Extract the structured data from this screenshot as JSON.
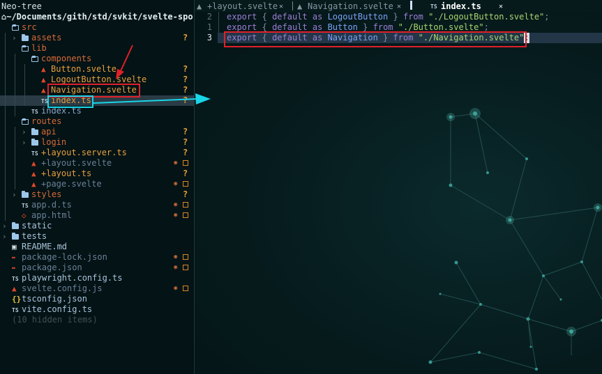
{
  "neotree": {
    "title": "Neo-tree",
    "root_path": "~/Documents/gith/std/svkit/svelte-spo",
    "hidden_items": "(10 hidden items)",
    "items": [
      {
        "label": "src",
        "kind": "folder-open",
        "icon": "folder-open-icon",
        "color": "#d86a3a",
        "git": ""
      },
      {
        "label": "assets",
        "kind": "folder",
        "icon": "folder-icon",
        "color": "#d86a3a",
        "git": "?"
      },
      {
        "label": "lib",
        "kind": "folder-open",
        "icon": "folder-open-icon",
        "color": "#d86a3a",
        "git": ""
      },
      {
        "label": "components",
        "kind": "folder-open",
        "icon": "folder-open-icon",
        "color": "#d86a3a",
        "git": ""
      },
      {
        "label": "Button.svelte",
        "kind": "svelte",
        "icon": "svelte-icon",
        "color": "#e8a040",
        "git": "?"
      },
      {
        "label": "LogoutButton.svelte",
        "kind": "svelte",
        "icon": "svelte-icon",
        "color": "#e8a040",
        "git": "?"
      },
      {
        "label": "Navigation.svelte",
        "kind": "svelte",
        "icon": "svelte-icon",
        "color": "#e8a040",
        "git": "?"
      },
      {
        "label": "index.ts",
        "kind": "ts",
        "icon": "typescript-icon",
        "color": "#e8a040",
        "git": "?"
      },
      {
        "label": "index.ts",
        "kind": "ts",
        "icon": "typescript-icon",
        "color": "#8aa6c8",
        "git": ""
      },
      {
        "label": "routes",
        "kind": "folder-open",
        "icon": "folder-open-icon",
        "color": "#d86a3a",
        "git": ""
      },
      {
        "label": "api",
        "kind": "folder",
        "icon": "folder-icon",
        "color": "#d86a3a",
        "git": "?"
      },
      {
        "label": "login",
        "kind": "folder",
        "icon": "folder-icon",
        "color": "#d86a3a",
        "git": "?"
      },
      {
        "label": "+layout.server.ts",
        "kind": "ts",
        "icon": "typescript-icon",
        "color": "#e8a040",
        "git": "?"
      },
      {
        "label": "+layout.svelte",
        "kind": "svelte",
        "icon": "svelte-icon",
        "color": "#6b8098",
        "git": "modified"
      },
      {
        "label": "+layout.ts",
        "kind": "svelte",
        "icon": "svelte-icon",
        "color": "#e8a040",
        "git": "?"
      },
      {
        "label": "+page.svelte",
        "kind": "svelte",
        "icon": "svelte-icon",
        "color": "#6b8098",
        "git": "modified"
      },
      {
        "label": "styles",
        "kind": "folder",
        "icon": "folder-icon",
        "color": "#d86a3a",
        "git": "?"
      },
      {
        "label": "app.d.ts",
        "kind": "ts",
        "icon": "typescript-icon",
        "color": "#6b8098",
        "git": "modified"
      },
      {
        "label": "app.html",
        "kind": "html",
        "icon": "html-icon",
        "color": "#6b8098",
        "git": "modified"
      },
      {
        "label": "static",
        "kind": "folder",
        "icon": "folder-icon",
        "color": "#a9c4dd",
        "git": ""
      },
      {
        "label": "tests",
        "kind": "folder",
        "icon": "folder-icon",
        "color": "#a9c4dd",
        "git": ""
      },
      {
        "label": "README.md",
        "kind": "md",
        "icon": "markdown-icon",
        "color": "#a9c4dd",
        "git": ""
      },
      {
        "label": "package-lock.json",
        "kind": "json",
        "icon": "npm-icon",
        "color": "#6b8098",
        "git": "modified"
      },
      {
        "label": "package.json",
        "kind": "json",
        "icon": "npm-icon",
        "color": "#6b8098",
        "git": "modified"
      },
      {
        "label": "playwright.config.ts",
        "kind": "ts",
        "icon": "typescript-icon",
        "color": "#a9c4dd",
        "git": ""
      },
      {
        "label": "svelte.config.js",
        "kind": "svelte",
        "icon": "svelte-icon",
        "color": "#6b8098",
        "git": "modified"
      },
      {
        "label": "tsconfig.json",
        "kind": "json",
        "icon": "json-braces-icon",
        "color": "#a9c4dd",
        "git": ""
      },
      {
        "label": "vite.config.ts",
        "kind": "ts",
        "icon": "typescript-icon",
        "color": "#a9c4dd",
        "git": ""
      }
    ]
  },
  "tabs": [
    {
      "label": "+layout.svelte",
      "icon": "svelte-icon",
      "active": false
    },
    {
      "label": "Navigation.svelte",
      "icon": "svelte-icon",
      "active": false
    },
    {
      "label": "index.ts",
      "icon": "typescript-icon",
      "active": true
    }
  ],
  "icons": {
    "ts": "TS",
    "git_untracked": "?",
    "braces": "{}"
  },
  "editor": {
    "line_numbers": [
      "2",
      "1",
      "3"
    ],
    "lines": [
      {
        "kw1": "export",
        "p1": "{",
        "kw2": "default",
        "kw3": "as",
        "name": "LogoutButton",
        "p2": "}",
        "kw4": "from",
        "str": "\"./LogoutButton.svelte\"",
        "end": ";"
      },
      {
        "kw1": "export",
        "p1": "{",
        "kw2": "default",
        "kw3": "as",
        "name": "Button",
        "p2": "}",
        "kw4": "from",
        "str": "\"./Button.svelte\"",
        "end": ";"
      },
      {
        "kw1": "export",
        "p1": "{",
        "kw2": "default",
        "kw3": "as",
        "name": "Navigation",
        "p2": "}",
        "kw4": "from",
        "str": "\"./Navigation.svelte\"",
        "end": ";"
      }
    ]
  },
  "colors": {
    "annotation_red": "#e0202a",
    "annotation_cyan": "#18d6e8",
    "selection": "#2a3b46",
    "git_untracked": "#e5a13a"
  }
}
